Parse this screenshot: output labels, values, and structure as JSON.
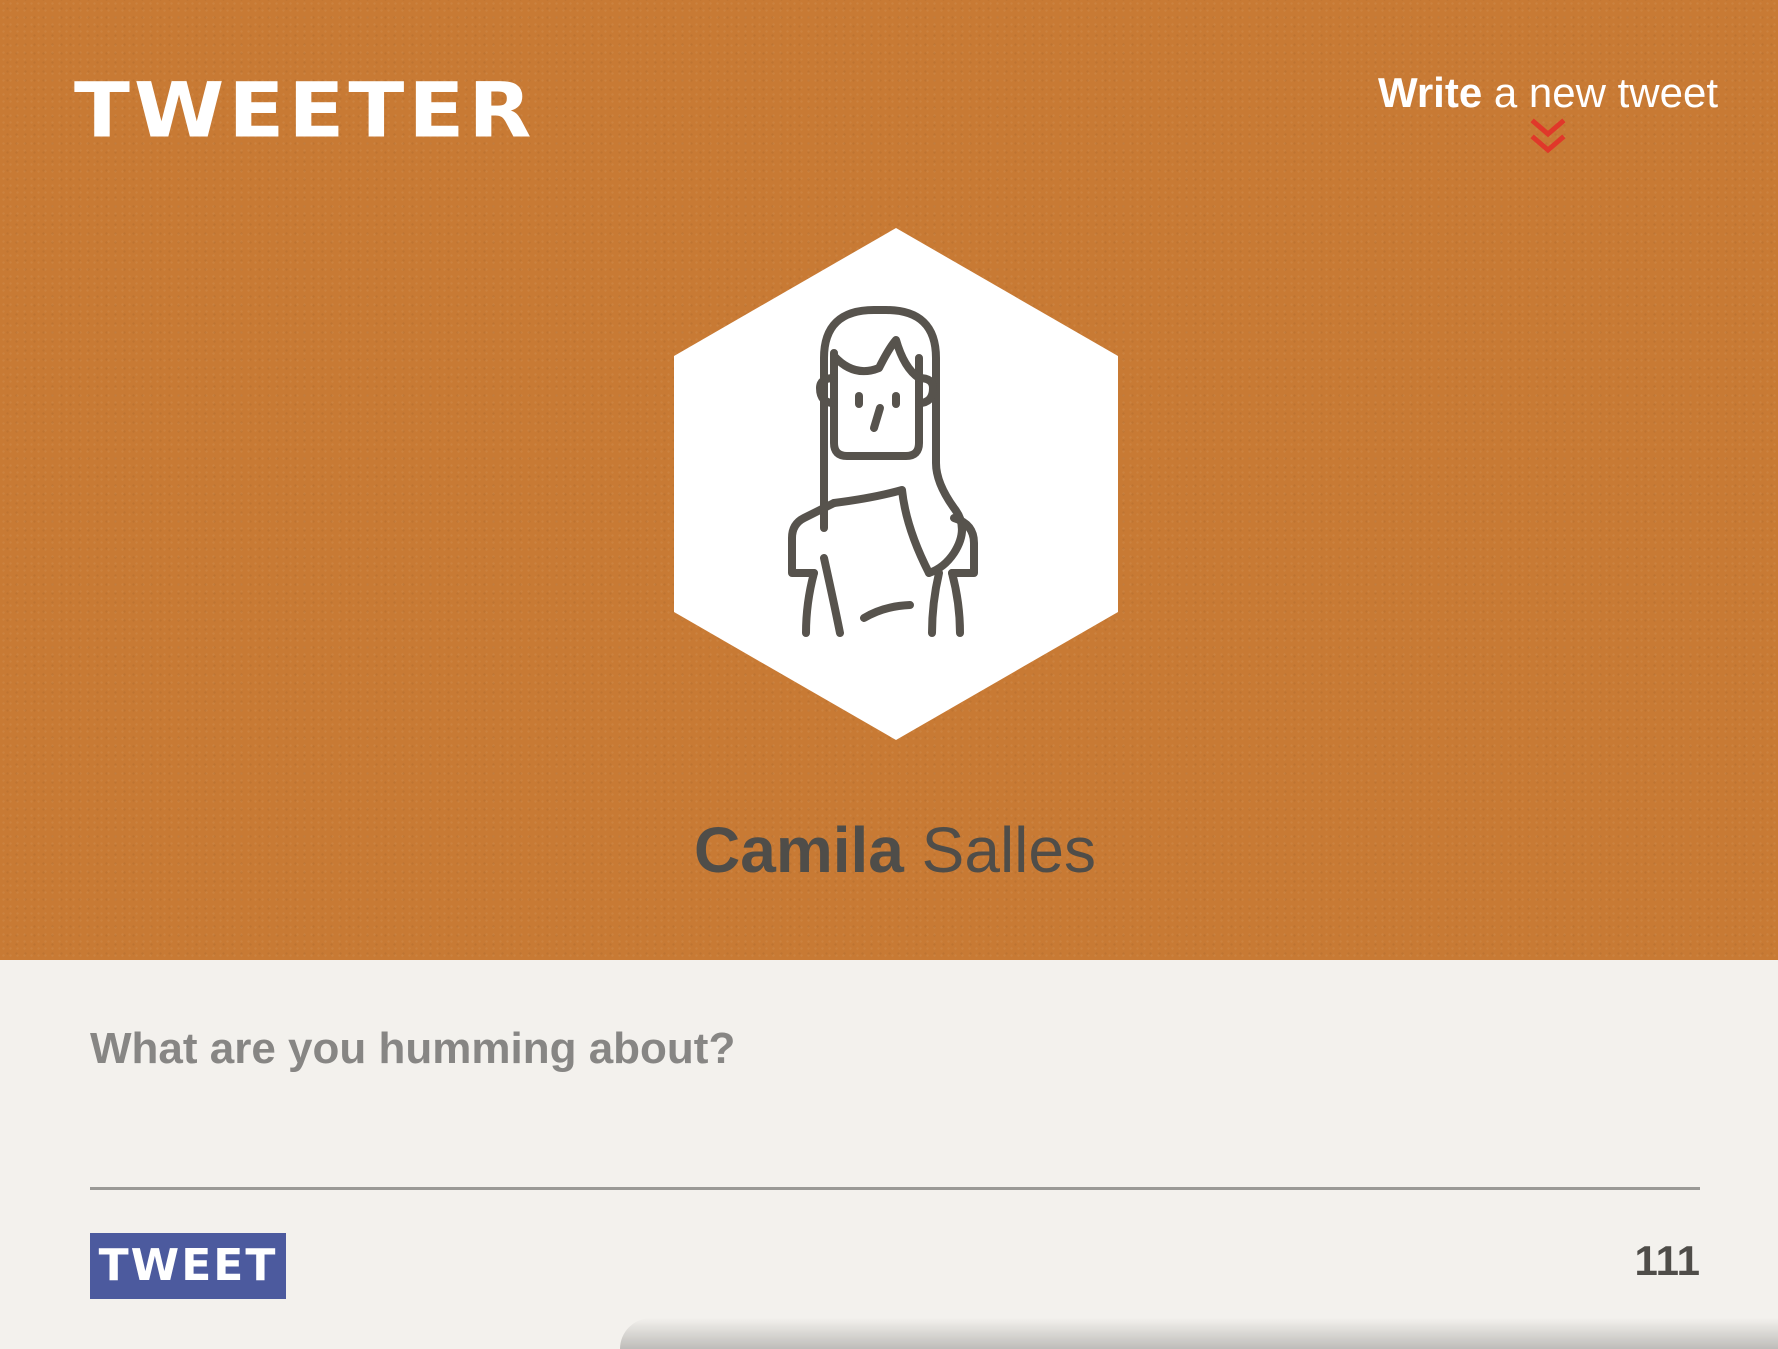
{
  "app": {
    "logo_text": "TWEETER"
  },
  "header": {
    "write_link": {
      "bold": "Write",
      "rest": " a new tweet"
    },
    "chevron_icon": "double-chevron-down-icon",
    "background_color": "#c87a34",
    "chevron_color": "#e0382a"
  },
  "profile": {
    "avatar_icon": "woman-avatar-icon",
    "first_name": "Camila",
    "last_name": " Salles"
  },
  "compose": {
    "placeholder": "What are you humming about?",
    "value": "",
    "tweet_button_label": "TWEET",
    "char_count": "111",
    "button_color": "#4c5a9e"
  }
}
